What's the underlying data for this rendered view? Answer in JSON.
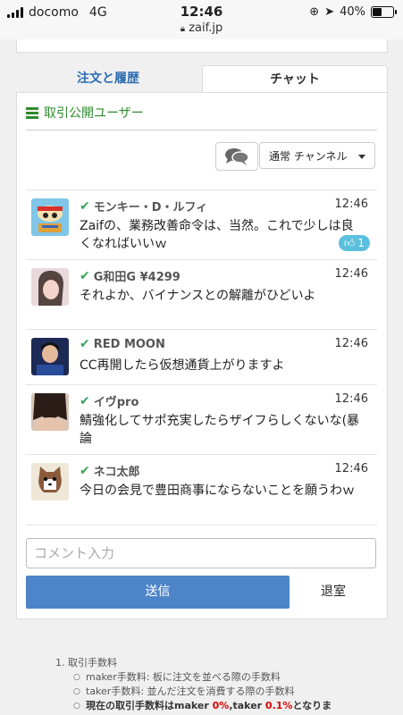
{
  "status_bar": {
    "carrier": "docomo",
    "network": "4G",
    "time": "12:46",
    "url": "zaif.jp",
    "battery": "40%",
    "battery_level": 0.4
  },
  "tabs": [
    {
      "label": "注文と履歴",
      "active": false
    },
    {
      "label": "チャット",
      "active": true
    }
  ],
  "users_link": "取引公開ユーザー",
  "channel_select": {
    "selected": "通常 チャンネル"
  },
  "messages": [
    {
      "name": "モンキー・D・ルフィ",
      "time": "12:46",
      "text": "Zaifの、業務改善命令は、当然。これで少しは良くなればいいｗ",
      "likes": "1"
    },
    {
      "name": "G和田G ¥4299",
      "time": "12:46",
      "text": "それよか、バイナンスとの解離がひどいよ"
    },
    {
      "name": "RED MOON",
      "time": "12:46",
      "text": "CC再開したら仮想通貨上がりますよ"
    },
    {
      "name": "イヴpro",
      "time": "12:46",
      "text": "鯖強化してサポ充実したらザイフらしくないな(暴論"
    },
    {
      "name": "ネコ太郎",
      "time": "12:46",
      "text": "今日の会見で豊田商事にならないことを願うわｗ"
    }
  ],
  "comment": {
    "placeholder": "コメント入力",
    "value": ""
  },
  "send_label": "送信",
  "leave_label": "退室",
  "fees": {
    "heading": "1.  取引手数料",
    "maker": "maker手数料: 板に注文を並べる際の手数料",
    "taker": "taker手数料: 並んだ注文を消費する際の手数料",
    "current_prefix": "現在の取引手数料はmaker ",
    "maker_rate": "0%",
    "current_mid": ",taker ",
    "taker_rate": "0.1%",
    "current_suffix": "となりま"
  },
  "colors": {
    "accent_blue": "#4e84c9",
    "tab_blue": "#2b6cb0",
    "users_green": "#2e8b2e",
    "like_badge": "#5bc0de",
    "fee_red": "#dd0000"
  }
}
